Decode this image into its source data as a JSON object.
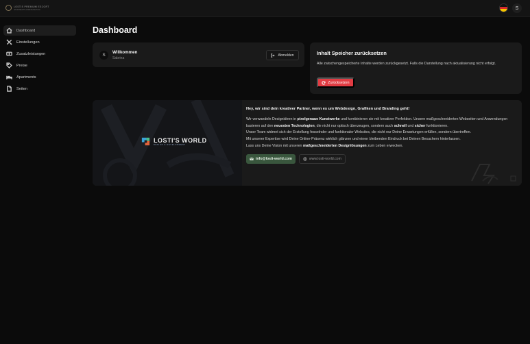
{
  "topbar": {
    "logo_line1": "LOSTIS PREMIUM ESCORT",
    "logo_line2": "APARTMENTS ADMINISTRATION",
    "language_flag": "de",
    "user_initial": "S"
  },
  "sidebar": {
    "items": [
      {
        "label": "Dashboard",
        "icon": "home-icon"
      },
      {
        "label": "Einstellungen",
        "icon": "tools-icon"
      },
      {
        "label": "Zusatzleistungen",
        "icon": "ticket-icon"
      },
      {
        "label": "Preise",
        "icon": "tag-icon"
      },
      {
        "label": "Apartments",
        "icon": "bed-icon"
      },
      {
        "label": "Seiten",
        "icon": "file-icon"
      }
    ]
  },
  "page": {
    "title": "Dashboard"
  },
  "welcome": {
    "initial": "S",
    "title": "Willkommen",
    "username": "Sabrina",
    "logout_label": "Abmelden"
  },
  "cache": {
    "title": "Inhalt Speicher zurücksetzen",
    "text": "Alle zwischengespeicherte Inhalte werden zurückgesetzt. Falls die Darstellung nach aktualisierung nicht erfolgt.",
    "button_label": "Zurücksetzen"
  },
  "partner": {
    "logo_title": "LOSTI'S WORLD",
    "logo_subtitle": "DESIGN & DEVELOPMENT",
    "heading": "Hey, wir sind dein kreativer Partner, wenn es um Webdesign, Grafiken und Branding geht!",
    "p1_a": "Wir verwandeln Designideen in ",
    "p1_b": "pixelgenaue Kunstwerke",
    "p1_c": " und kombinieren sie mit kreativer Perfektion. Unsere maßgeschneiderten Webseiten und Anwendungen basieren auf den ",
    "p1_d": "neuesten Technologien",
    "p1_e": ", die nicht nur optisch überzeugen, sondern auch ",
    "p1_f": "schnell",
    "p1_g": " und ",
    "p1_h": "sicher",
    "p1_i": " funktionieren.",
    "p2": "Unser Team widmet sich der Erstellung fesselnder und funktionaler Websites, die nicht nur Deine Erwartungen erfüllen, sondern übertreffen.",
    "p3": "Mit unserer Expertise wird Deine Online-Präsenz wirklich glänzen und einen bleibenden Eindruck bei Deinen Besuchern hinterlassen.",
    "p4_a": "Lass uns Deine Vision mit unseren ",
    "p4_b": "maßgeschneiderten Designlösungen",
    "p4_c": " zum Leben erwecken.",
    "email_label": "info@losti-world.com",
    "web_label": "www.losti-world.com"
  },
  "colors": {
    "background": "#0b0b0b",
    "card": "#1a1a1a",
    "danger": "#e23c43",
    "email_button": "#39563d"
  }
}
